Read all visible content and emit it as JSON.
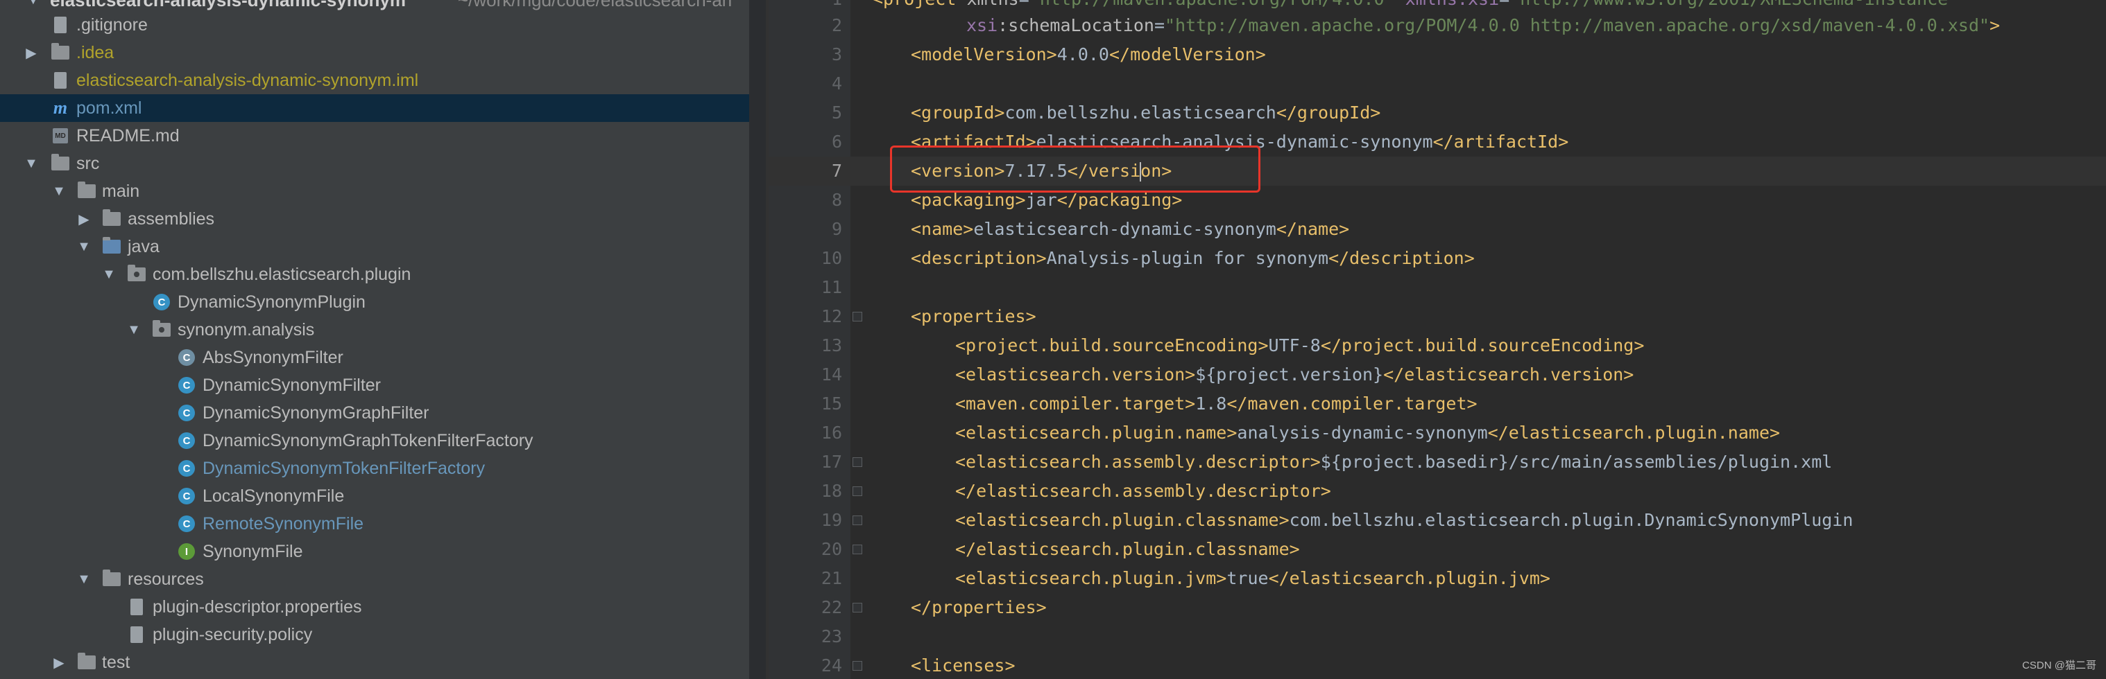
{
  "project": {
    "root": {
      "name": "elasticsearch-analysis-dynamic-synonym",
      "path": "~/work/mgd/code/elasticsearch-an"
    },
    "items": [
      {
        "label": "elasticsearch-analysis-dynamic-synonym",
        "path": "~/work/mgd/code/elasticsearch-an"
      },
      {
        "label": ".gitignore"
      },
      {
        "label": ".idea"
      },
      {
        "label": "elasticsearch-analysis-dynamic-synonym.iml"
      },
      {
        "label": "pom.xml"
      },
      {
        "label": "README.md"
      },
      {
        "label": "src"
      },
      {
        "label": "main"
      },
      {
        "label": "assemblies"
      },
      {
        "label": "java"
      },
      {
        "label": "com.bellszhu.elasticsearch.plugin"
      },
      {
        "label": "DynamicSynonymPlugin"
      },
      {
        "label": "synonym.analysis"
      },
      {
        "label": "AbsSynonymFilter"
      },
      {
        "label": "DynamicSynonymFilter"
      },
      {
        "label": "DynamicSynonymGraphFilter"
      },
      {
        "label": "DynamicSynonymGraphTokenFilterFactory"
      },
      {
        "label": "DynamicSynonymTokenFilterFactory"
      },
      {
        "label": "LocalSynonymFile"
      },
      {
        "label": "RemoteSynonymFile"
      },
      {
        "label": "SynonymFile"
      },
      {
        "label": "resources"
      },
      {
        "label": "plugin-descriptor.properties"
      },
      {
        "label": "plugin-security.policy"
      },
      {
        "label": "test"
      }
    ],
    "icons": {
      "maven_glyph": "m",
      "class_glyph": "C",
      "abstract_glyph": "C",
      "interface_glyph": "I",
      "md_glyph": "MD"
    }
  },
  "editor": {
    "lines": [
      {
        "num": "1",
        "parts": [
          "<project ",
          "xmlns",
          "=",
          "\"http://maven.apache.org/POM/4.0.0\"",
          " ",
          "xmlns:xsi",
          "=",
          "\"http://www.w3.org/2001/XMLSchema-instance\""
        ]
      },
      {
        "num": "2",
        "parts": [
          "xsi",
          ":schemaLocation",
          "=",
          "\"http://maven.apache.org/POM/4.0.0 http://maven.apache.org/xsd/maven-4.0.0.xsd\"",
          ">"
        ]
      },
      {
        "num": "3",
        "parts": [
          "<modelVersion>",
          "4.0.0",
          "</modelVersion>"
        ]
      },
      {
        "num": "4",
        "parts": []
      },
      {
        "num": "5",
        "parts": [
          "<groupId>",
          "com.bellszhu.elasticsearch",
          "</groupId>"
        ]
      },
      {
        "num": "6",
        "parts": [
          "<artifactId>",
          "elasticsearch-analysis-dynamic-synonym",
          "</artifactId>"
        ]
      },
      {
        "num": "7",
        "parts": [
          "<version>",
          "7.17.5",
          "</versi",
          "on>"
        ]
      },
      {
        "num": "8",
        "parts": [
          "<packaging>",
          "jar",
          "</packaging>"
        ]
      },
      {
        "num": "9",
        "parts": [
          "<name>",
          "elasticsearch-dynamic-synonym",
          "</name>"
        ]
      },
      {
        "num": "10",
        "parts": [
          "<description>",
          "Analysis-plugin for synonym",
          "</description>"
        ]
      },
      {
        "num": "11",
        "parts": []
      },
      {
        "num": "12",
        "parts": [
          "<properties>"
        ]
      },
      {
        "num": "13",
        "parts": [
          "<project.build.sourceEncoding>",
          "UTF-8",
          "</project.build.sourceEncoding>"
        ]
      },
      {
        "num": "14",
        "parts": [
          "<elasticsearch.version>",
          "${project.version}",
          "</elasticsearch.version>"
        ]
      },
      {
        "num": "15",
        "parts": [
          "<maven.compiler.target>",
          "1.8",
          "</maven.compiler.target>"
        ]
      },
      {
        "num": "16",
        "parts": [
          "<elasticsearch.plugin.name>",
          "analysis-dynamic-synonym",
          "</elasticsearch.plugin.name>"
        ]
      },
      {
        "num": "17",
        "parts": [
          "<elasticsearch.assembly.descriptor>",
          "${project.basedir}/src/main/assemblies/plugin.xml"
        ]
      },
      {
        "num": "18",
        "parts": [
          "</elasticsearch.assembly.descriptor>"
        ]
      },
      {
        "num": "19",
        "parts": [
          "<elasticsearch.plugin.classname>",
          "com.bellszhu.elasticsearch.plugin.DynamicSynonymPlugin"
        ]
      },
      {
        "num": "20",
        "parts": [
          "</elasticsearch.plugin.classname>"
        ]
      },
      {
        "num": "21",
        "parts": [
          "<elasticsearch.plugin.jvm>",
          "true",
          "</elasticsearch.plugin.jvm>"
        ]
      },
      {
        "num": "22",
        "parts": [
          "</properties>"
        ]
      },
      {
        "num": "23",
        "parts": []
      },
      {
        "num": "24",
        "parts": [
          "<licenses>"
        ]
      }
    ]
  },
  "watermark": "CSDN @猫二哥",
  "colors": {
    "tag": "#e8bf6a",
    "string": "#6a8759",
    "highlight_box": "#e8352a",
    "selection": "#0d293e"
  }
}
